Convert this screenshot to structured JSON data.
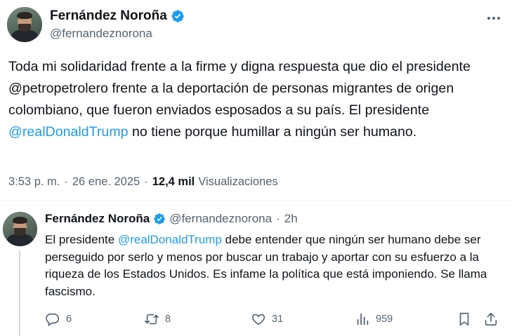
{
  "tweet": {
    "author": {
      "name": "Fernández Noroña",
      "handle": "@fernandeznorona",
      "verified": true
    },
    "text_parts": {
      "p1": "Toda mi solidaridad frente a la firme y digna respuesta que dio el presidente @petropetrolero frente a la deportación de personas migrantes de origen colombiano, que fueron enviados esposados a su país. El presidente ",
      "mention": "@realDonaldTrump",
      "p2": " no tiene porque humillar a ningún ser humano."
    },
    "time": "3:53 p. m.",
    "separator": "·",
    "date": "26 ene. 2025",
    "views_count": "12,4 mil",
    "views_label": "Visualizaciones"
  },
  "reply": {
    "author": {
      "name": "Fernández Noroña",
      "handle": "@fernandeznorona",
      "verified": true
    },
    "separator": "·",
    "time_ago": "2h",
    "text_parts": {
      "p1": "El presidente ",
      "mention": "@realDonaldTrump",
      "p2": " debe entender que ningún ser humano debe ser perseguido por serlo y menos por buscar un trabajo y aportar con su esfuerzo a la riqueza de los Estados Unidos. Es infame la política que está imponiendo. Se llama fascismo."
    },
    "actions": {
      "replies": "6",
      "retweets": "8",
      "likes": "31",
      "views": "959"
    }
  },
  "colors": {
    "text": "#0f1419",
    "secondary": "#536471",
    "link": "#1d9bf0",
    "verified": "#1d9bf0"
  }
}
